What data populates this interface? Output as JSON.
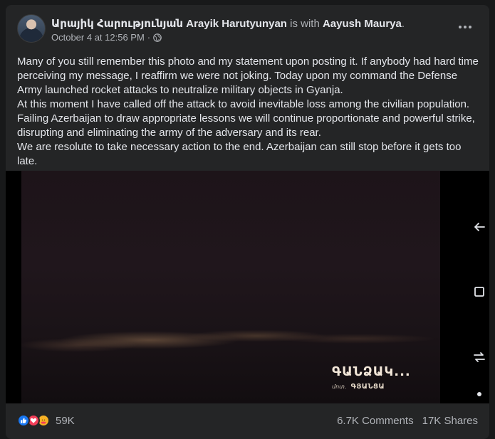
{
  "post": {
    "author": "Արայիկ Հարությունյան Arayik Harutyunyan",
    "with_text": " is with ",
    "tagged": "Aayush Maurya",
    "tagged_suffix": ".",
    "timestamp": "October 4 at 12:56 PM",
    "separator": "·",
    "body": [
      "Many of you still remember this photo and my statement upon posting it. If anybody had hard time perceiving my message, I reaffirm we were not joking. Today upon my command the Defense Army launched rocket attacks to neutralize military objects in Gyanja.",
      "At this moment I have called off the attack to avoid inevitable loss among the civilian population. Failing Azerbaijan to draw appropriate lessons we will continue proportionate and powerful strike, disrupting and eliminating the army of the adversary and its rear.",
      "We are resolute to take necessary action to the end. Azerbaijan can still stop before it gets too late."
    ],
    "photo_caption": {
      "title": "ԳԱՆՁԱԿ...",
      "prefix": "մոտ․",
      "name": "ԳՅԱՆՑԱ"
    }
  },
  "footer": {
    "reaction_count": "59K",
    "comments": "6.7K Comments",
    "shares": "17K Shares"
  },
  "icons": [
    "globe-icon",
    "more-icon",
    "back-icon",
    "recents-icon",
    "rotate-icon",
    "dot-icon",
    "like-icon",
    "love-icon",
    "care-icon"
  ],
  "colors": {
    "background": "#18191a",
    "card": "#242526",
    "primary_text": "#e4e6eb",
    "secondary_text": "#b0b3b8",
    "like": "#1877f2",
    "love": "#f33e58",
    "care": "#f7b125"
  }
}
